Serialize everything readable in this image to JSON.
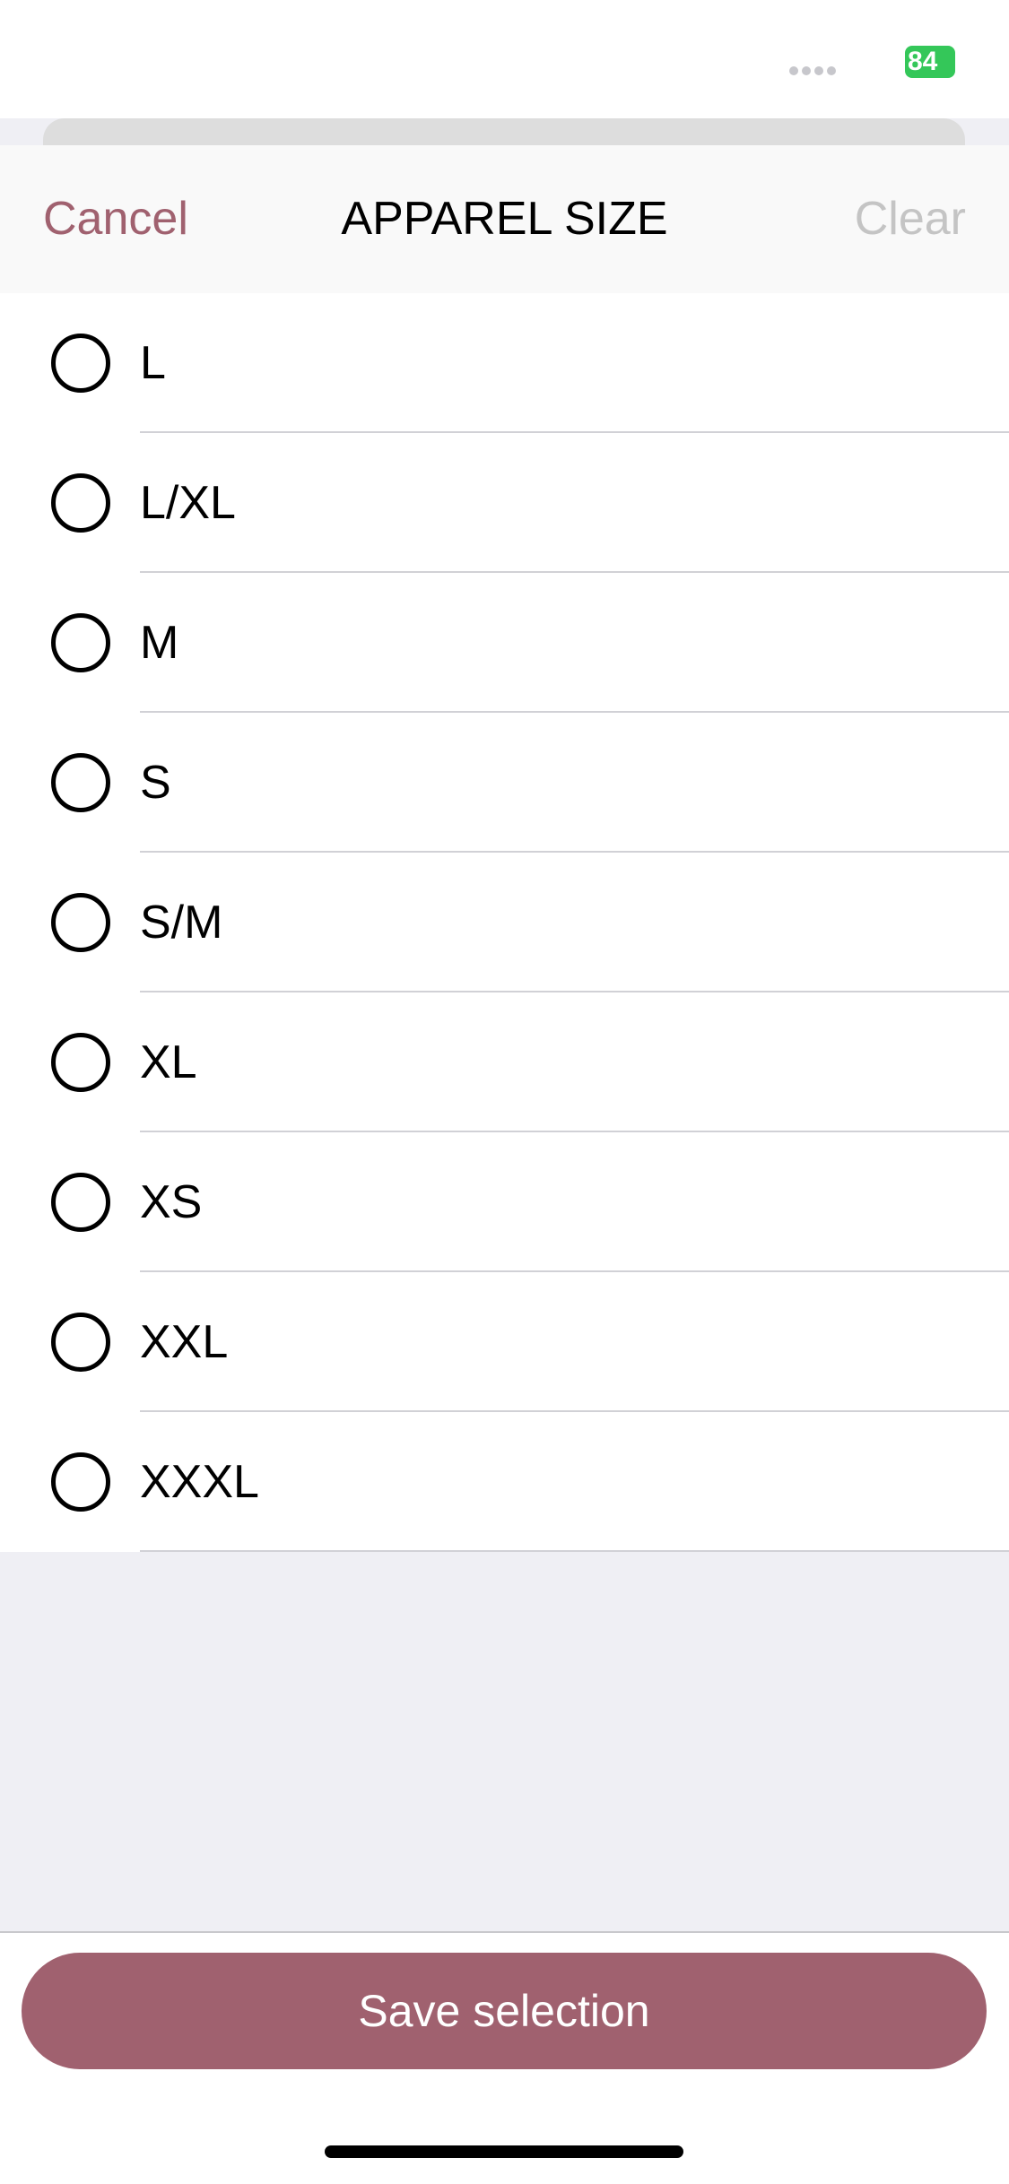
{
  "status_bar": {
    "battery": "84",
    "battery_color": "#34c759"
  },
  "header": {
    "cancel_label": "Cancel",
    "title": "APPAREL SIZE",
    "clear_label": "Clear"
  },
  "options": [
    {
      "label": "L",
      "selected": false
    },
    {
      "label": "L/XL",
      "selected": false
    },
    {
      "label": "M",
      "selected": false
    },
    {
      "label": "S",
      "selected": false
    },
    {
      "label": "S/M",
      "selected": false
    },
    {
      "label": "XL",
      "selected": false
    },
    {
      "label": "XS",
      "selected": false
    },
    {
      "label": "XXL",
      "selected": false
    },
    {
      "label": "XXXL",
      "selected": false
    }
  ],
  "footer": {
    "save_label": "Save selection"
  },
  "colors": {
    "accent": "#a0616f",
    "disabled_text": "#c4c4c4",
    "background": "#efeff4"
  }
}
